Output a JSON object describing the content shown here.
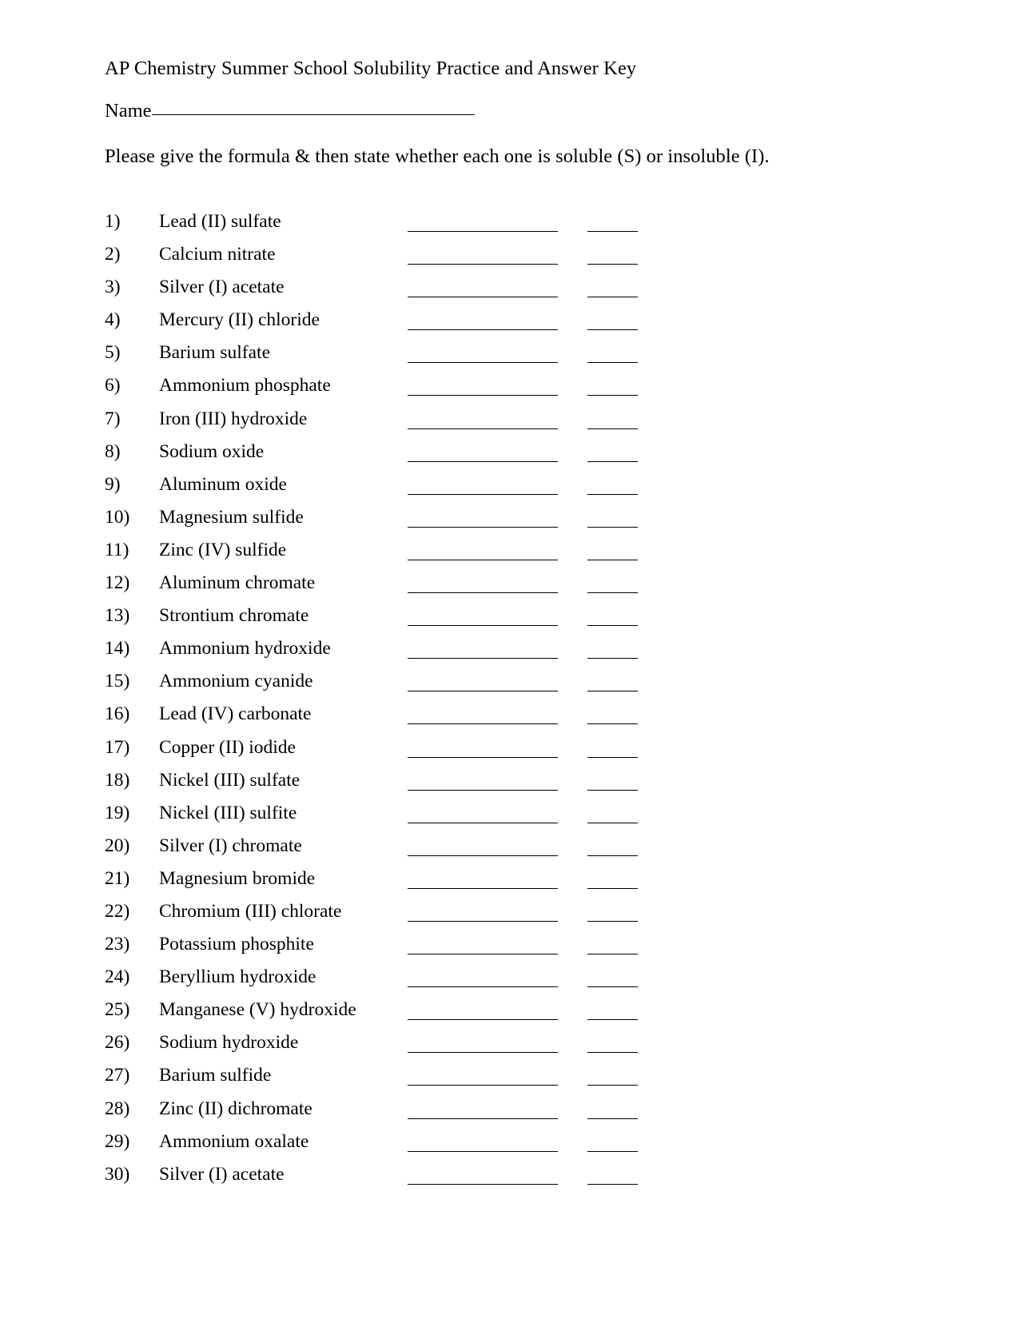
{
  "document": {
    "title": "AP Chemistry Summer School Solubility Practice and Answer Key",
    "name_label": "Name",
    "instruction": "Please give the formula & then state whether each one is soluble (S) or insoluble (I)."
  },
  "items": [
    {
      "number": "1)",
      "name": "Lead (II) sulfate"
    },
    {
      "number": "2)",
      "name": "Calcium nitrate"
    },
    {
      "number": "3)",
      "name": "Silver (I) acetate"
    },
    {
      "number": "4)",
      "name": "Mercury (II) chloride"
    },
    {
      "number": "5)",
      "name": "Barium sulfate"
    },
    {
      "number": "6)",
      "name": "Ammonium phosphate"
    },
    {
      "number": "7)",
      "name": "Iron (III) hydroxide"
    },
    {
      "number": "8)",
      "name": "Sodium oxide"
    },
    {
      "number": "9)",
      "name": "Aluminum oxide"
    },
    {
      "number": "10)",
      "name": "Magnesium sulfide"
    },
    {
      "number": "11)",
      "name": "Zinc (IV) sulfide"
    },
    {
      "number": "12)",
      "name": "Aluminum chromate"
    },
    {
      "number": "13)",
      "name": "Strontium chromate"
    },
    {
      "number": "14)",
      "name": "Ammonium hydroxide"
    },
    {
      "number": "15)",
      "name": "Ammonium cyanide"
    },
    {
      "number": "16)",
      "name": "Lead (IV) carbonate"
    },
    {
      "number": "17)",
      "name": "Copper (II) iodide"
    },
    {
      "number": "18)",
      "name": "Nickel (III) sulfate"
    },
    {
      "number": "19)",
      "name": "Nickel (III) sulfite"
    },
    {
      "number": "20)",
      "name": "Silver (I) chromate"
    },
    {
      "number": "21)",
      "name": "Magnesium bromide"
    },
    {
      "number": "22)",
      "name": "Chromium (III) chlorate"
    },
    {
      "number": "23)",
      "name": "Potassium phosphite"
    },
    {
      "number": "24)",
      "name": "Beryllium hydroxide"
    },
    {
      "number": "25)",
      "name": "Manganese (V) hydroxide"
    },
    {
      "number": "26)",
      "name": "Sodium hydroxide"
    },
    {
      "number": "27)",
      "name": "Barium sulfide"
    },
    {
      "number": "28)",
      "name": "Zinc (II) dichromate"
    },
    {
      "number": "29)",
      "name": "Ammonium oxalate"
    },
    {
      "number": "30)",
      "name": "Silver (I) acetate"
    }
  ]
}
